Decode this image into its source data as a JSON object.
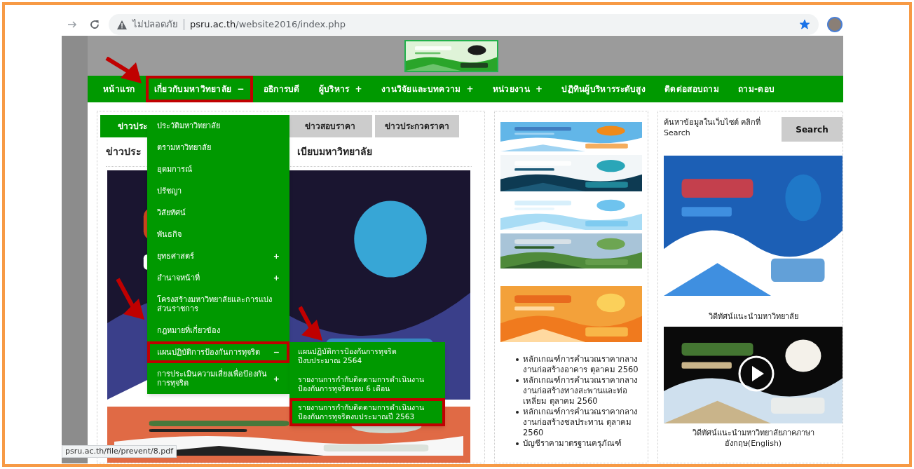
{
  "browser": {
    "security_label": "ไม่ปลอดภัย",
    "url_host": "psru.ac.th",
    "url_path": "/website2016/index.php",
    "bookmarked": true
  },
  "nav": [
    {
      "label": "หน้าแรก",
      "highlighted": false
    },
    {
      "label": "เกี่ยวกับมหาวิทยาลัย",
      "toggle": "−",
      "highlighted": true
    },
    {
      "label": "อธิการบดี",
      "highlighted": false
    },
    {
      "label": "ผู้บริหาร",
      "toggle": "+",
      "highlighted": false
    },
    {
      "label": "งานวิจัยและบทความ",
      "toggle": "+",
      "highlighted": false
    },
    {
      "label": "หน่วยงาน",
      "toggle": "+",
      "highlighted": false
    },
    {
      "label": "ปฏิทินผู้บริหารระดับสูง",
      "highlighted": false
    },
    {
      "label": "ติดต่อสอบถาม",
      "highlighted": false
    },
    {
      "label": "ถาม-ดอบ",
      "highlighted": false
    }
  ],
  "dropdown": [
    {
      "label": "ประวัติมหาวิทยาลัย",
      "highlighted": false
    },
    {
      "label": "ตรามหาวิทยาลัย",
      "highlighted": false
    },
    {
      "label": "อุดมการณ์",
      "highlighted": false
    },
    {
      "label": "ปรัชญา",
      "highlighted": false
    },
    {
      "label": "วิสัยทัศน์",
      "highlighted": false
    },
    {
      "label": "พันธกิจ",
      "highlighted": false
    },
    {
      "label": "ยุทธศาสตร์",
      "toggle": "+",
      "highlighted": false
    },
    {
      "label": "อำนาจหน้าที่",
      "toggle": "+",
      "highlighted": false
    },
    {
      "label": "โครงสร้างมหาวิทยาลัยและการแบ่งส่วนราชการ",
      "highlighted": false
    },
    {
      "label": "กฎหมายที่เกี่ยวข้อง",
      "highlighted": false
    },
    {
      "label": "แผนปฏิบัติการป้องกันการทุจริต",
      "toggle": "−",
      "highlighted": true,
      "expanded": true,
      "children": [
        {
          "label": "แผนปฏิบัติการป้องกันการทุจริตปีงบประมาณ 2564",
          "highlighted": false
        },
        {
          "label": "รายงานการกำกับติดตามการดำเนินงานป้องกันการทุจริตรอบ 6 เดือน",
          "highlighted": false
        },
        {
          "label": "รายงานการกำกับติดตามการดำเนินงานป้องกันการทุจริตงบประมาณปี 2563",
          "highlighted": true
        }
      ]
    },
    {
      "label": "การประเมินความเสี่ยงเพื่อป้องกันการทุจริต",
      "toggle": "+",
      "highlighted": false
    }
  ],
  "news_tabs": [
    {
      "label": "ข่าวประ",
      "selected": true
    },
    {
      "label": "ข่าวสอบราคา",
      "selected": false
    },
    {
      "label": "ข่าวประกวดราคา",
      "selected": false
    }
  ],
  "news_heading": {
    "start": "ข่าวประ",
    "end": "เบียบมหาวิทยาลัย"
  },
  "price_list": [
    "หลักเกณฑ์การคำนวณราคากลางงานก่อสร้างอาคาร ตุลาคม 2560",
    "หลักเกณฑ์การคำนวณราคากลางงานก่อสร้างทางสะพานและท่อเหลี่ยม ตุลาคม 2560",
    "หลักเกณฑ์การคำนวณราคากลางงานก่อสร้างชลประทาน ตุลาคม 2560",
    "บัญชีราคามาตรฐานครุภัณฑ์"
  ],
  "search": {
    "hint": "ค้นหาข้อมูลในเว็บไซต์ คลิกที่ Search",
    "button": "Search"
  },
  "video": {
    "title": "วิดีทัศน์แนะนำมหาวิทยาลัย",
    "caption": "วิดีทัศน์แนะนำมหาวิทยาลัยภาคภาษาอังกฤษ(English)"
  },
  "status_bar": "psru.ac.th/file/prevent/8.pdf"
}
